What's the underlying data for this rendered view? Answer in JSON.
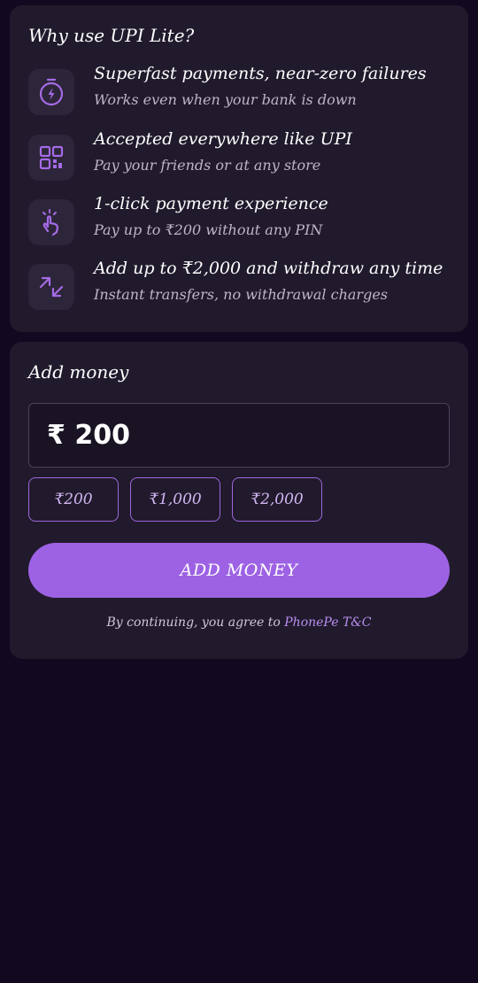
{
  "why": {
    "title": "Why use UPI Lite?",
    "features": [
      {
        "icon": "lightning-timer-icon",
        "title": "Superfast payments,  near-zero failures",
        "subtitle": "Works even when your bank is down"
      },
      {
        "icon": "qr-code-icon",
        "title": "Accepted everywhere like UPI",
        "subtitle": "Pay your friends or at any store"
      },
      {
        "icon": "tap-hand-icon",
        "title": "1-click payment experience",
        "subtitle": "Pay up to ₹200 without any PIN"
      },
      {
        "icon": "transfer-arrows-icon",
        "title": "Add up to ₹2,000 and withdraw any time",
        "subtitle": "Instant transfers, no withdrawal charges"
      }
    ]
  },
  "add_money": {
    "title": "Add money",
    "amount_value": "₹ 200",
    "chips": [
      "₹200",
      "₹1,000",
      "₹2,000"
    ],
    "button_label": "ADD MONEY",
    "terms_prefix": "By continuing, you agree to ",
    "terms_link": "PhonePe T&C"
  },
  "colors": {
    "background": "#120820",
    "card": "#211a2c",
    "accent": "#9d62e4",
    "icon": "#a46be6"
  }
}
